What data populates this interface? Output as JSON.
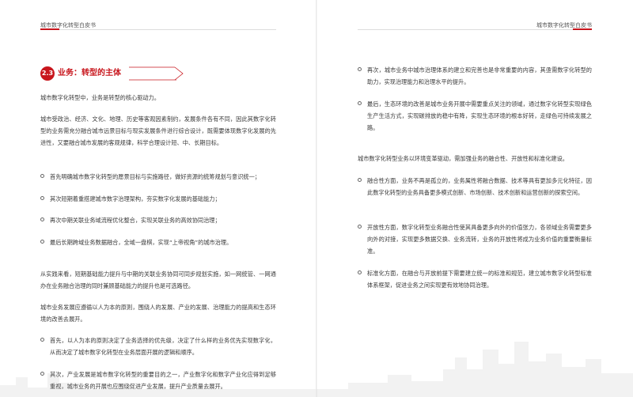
{
  "header": {
    "left_title": "城市数字化转型白皮书",
    "right_title": "城市数字化转型白皮书"
  },
  "section": {
    "number": "2.3",
    "title": "业务：转型的主体"
  },
  "left_page": {
    "p1": "城市数字化转型中，业务是转型的核心驱动力。",
    "p2": "城市受政治、经济、文化、地理、历史等客观因素制约，发展条件各有不同，因此其数字化转型的业务需充分融合城市远景目标与现实发展条件进行综合设计，既需要体现数字化发展的先进性，又要融合城市发展的客观规律，科学合理设计短、中、长期目标。",
    "bullets1": [
      "首先明确城市数字化转型的愿景目标与实施路径，做好资源的统筹规划与意识统一；",
      "其次短期着重搭建城市数字治理架构，夯实数字化发展的基础能力；",
      "再次中期关联业务域流程优化整合，实现关联业务的高效协同治理；",
      "最后长期跨域业务数据融合，全域一盘棋，实现“上帝视角”的城市治理。"
    ],
    "p3": "从实践来看，短期基础能力提升与中期的关联业务协同可同步规划实施，如一网统管、一网通办在业务融合治理的同时兼顾基础能力的提升也是可选路径。",
    "p4": "城市业务发展应遵循以人为本的原则，围绕人的发展、产业的发展、治理能力的提高和生态环境的改善去展开。",
    "bullets2": [
      "首先，以人为本的原则决定了业务选择的优先级，决定了什么样的业务优先实现数字化，从而决定了城市数字化转型在业务层面开展的逻辑和顺序。",
      "其次，产业发展是城市数字化转型的重要目的之一，产业数字化和数字产业化应得到足够重视，城市业务的开展也应围绕促进产业发展，提升产业质量去展开。"
    ]
  },
  "right_page": {
    "bullets1": [
      "再次，城市业务中城市治理体系的建立和完善也是非常重要的内容，其亟需数字化转型的助力，实现治理能力和治理水平的提升。",
      "最后，生态环境的改善是城市业务开展中需要重点关注的领域，通过数字化转型实现绿色生产生活方式，实现碳排放的稳中有降，实现生态环境的根本好转，走绿色可持续发展之路。"
    ],
    "p1": "城市数字化转型业务以环境变革驱动，需加强业务的融合性、开放性和标准化建设。",
    "bullets2": [
      "融合性方面，业务不再是孤立的，业务属性将融合数据、技术等具有更加多元化特征，因此数字化转型的业务具备更多模式创新、市场创新、技术创新和运营创新的探索空间。",
      "开放性方面，数字化转型业务融合性使其具备更多向外的价值张力，各领域业务需要更多向外的对接，实现更多数据交换、业务流转，业务的开放性将成为业务价值的重要衡量标准。",
      "标准化方面，在融合与开放前提下需要建立统一的标准和规范，建立城市数字化转型标准体系框架，促进业务之间实现更有效地协同治理。"
    ]
  }
}
